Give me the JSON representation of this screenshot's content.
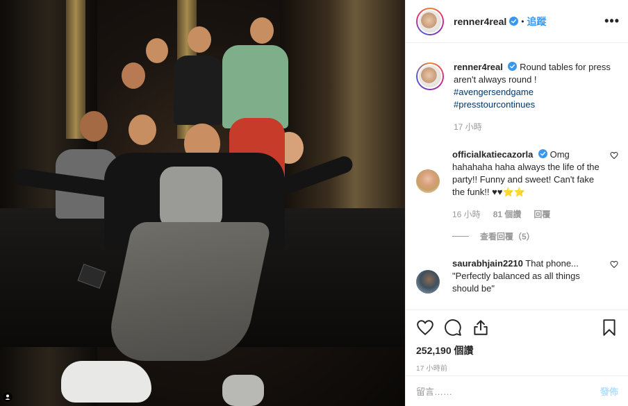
{
  "post": {
    "username": "renner4real",
    "follow_separator": "•",
    "follow_label": "追蹤",
    "more_label": "•••"
  },
  "caption": {
    "username": "renner4real",
    "text": "Round tables for press aren't always round !",
    "hashtags": [
      "#avengersendgame",
      "#presstourcontinues"
    ],
    "time": "17 小時"
  },
  "comments": [
    {
      "username": "officialkatiecazorla",
      "verified": true,
      "text": "Omg hahahaha haha always the life of the party!! Funny and sweet! Can't fake the funk!! ♥♥⭐⭐",
      "time": "16 小時",
      "likes": "81 個讚",
      "reply_label": "回覆",
      "view_replies": "查看回覆（5）"
    },
    {
      "username": "saurabhjain2210",
      "verified": false,
      "text": "That phone... \"Perfectly balanced as all things should be\""
    }
  ],
  "stats": {
    "views": "252,190 個讚",
    "posted_ago": "17 小時前"
  },
  "add_comment": {
    "placeholder": "留言……",
    "post_label": "發佈"
  },
  "colors": {
    "link_blue": "#3897f0",
    "hashtag": "#003569",
    "muted": "#999999"
  },
  "icons": [
    "more-options-icon",
    "verified-badge-icon",
    "heart-icon",
    "comment-icon",
    "share-icon",
    "bookmark-icon",
    "user-tag-icon"
  ]
}
